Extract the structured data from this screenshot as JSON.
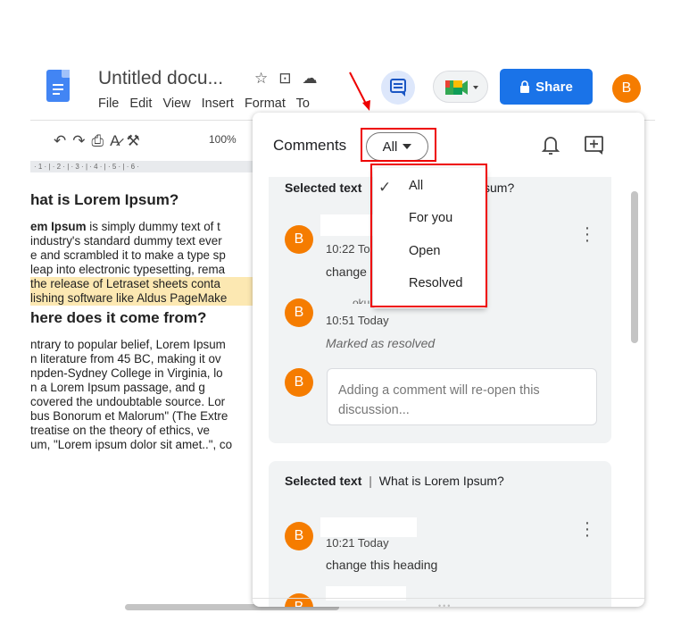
{
  "header": {
    "doc_title": "Untitled docu...",
    "menu": [
      "File",
      "Edit",
      "View",
      "Insert",
      "Format",
      "To"
    ],
    "share_label": "Share",
    "user_initial": "B",
    "accent": "#1a73e8",
    "avatar_color": "#f57c00"
  },
  "toolbar": {
    "zoom": "100%",
    "ruler_text": "· 1 · | · 2 · | · 3 · | · 4 · | · 5 · | · 6 ·"
  },
  "document": {
    "heading1": "hat is Lorem Ipsum?",
    "para1_bold": "em Ipsum",
    "para1_first": " is simply dummy text of t",
    "para1_lines": [
      "industry's standard dummy text ever",
      "e and scrambled it to make a type sp",
      "leap into electronic typesetting, rema"
    ],
    "para1_highlighted": [
      "the release of Letraset sheets conta",
      "lishing software like Aldus PageMake"
    ],
    "heading2": "here does it come from?",
    "para2_lines": [
      "ntrary to popular belief, Lorem Ipsum",
      "n literature from 45 BC, making it ov",
      "npden-Sydney College in Virginia, lo",
      "n a Lorem Ipsum passage, and g",
      "covered the undoubtable source. Lor",
      "bus Bonorum et Malorum\" (The Extre",
      "treatise on the theory of ethics, ve",
      "um, \"Lorem ipsum dolor sit amet..\", co"
    ]
  },
  "comments_panel": {
    "title": "Comments",
    "filter_value": "All",
    "filter_options": [
      "All",
      "For you",
      "Open",
      "Resolved"
    ],
    "filter_selected": "All",
    "thread1": {
      "selected_prefix": "Selected text",
      "selected_tail": "sum?",
      "comment1_time": "10:22 To",
      "comment1_text": "change",
      "comment2_name_fragment": "oku",
      "comment2_time": "10:51 Today",
      "comment2_status": "Marked as resolved",
      "reply_placeholder": "Adding a comment will re-open this discussion..."
    },
    "thread2": {
      "selected_prefix": "Selected text",
      "separator": "|",
      "selected_quote": "What is Lorem Ipsum?",
      "comment1_time": "10:21 Today",
      "comment1_text": "change this heading"
    }
  }
}
